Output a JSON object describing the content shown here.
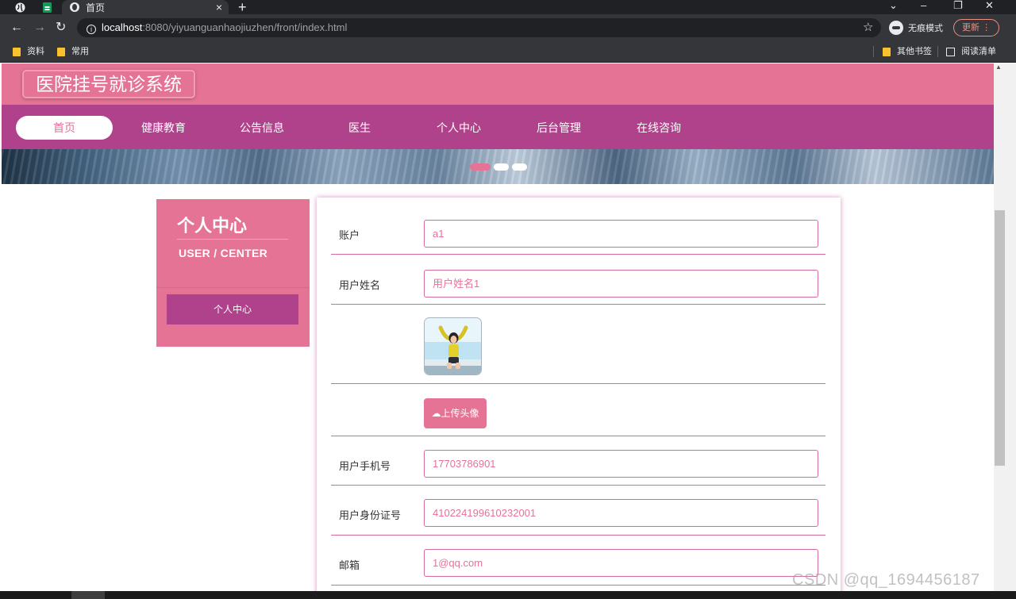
{
  "browser": {
    "tab_title": "首页",
    "address_host": "localhost",
    "address_path": ":8080/yiyuanguanhaojiuzhen/front/index.html",
    "incognito_label": "无痕模式",
    "update_label": "更新",
    "bookmarks": [
      "资料",
      "常用"
    ],
    "other_bookmarks": "其他书签",
    "reading_list": "阅读清单"
  },
  "site": {
    "title": "医院挂号就诊系统",
    "nav": [
      "首页",
      "健康教育",
      "公告信息",
      "医生",
      "个人中心",
      "后台管理",
      "在线咨询"
    ],
    "active_nav": "首页"
  },
  "sidebar": {
    "title": "个人中心",
    "subtitle": "USER / CENTER",
    "menu_item": "个人中心"
  },
  "form": {
    "account_label": "账户",
    "account_value": "a1",
    "name_label": "用户姓名",
    "name_value": "用户姓名1",
    "upload_label": "上传头像",
    "phone_label": "用户手机号",
    "phone_value": "17703786901",
    "idcard_label": "用户身份证号",
    "idcard_value": "410224199610232001",
    "email_label": "邮箱",
    "email_value": "1@qq.com"
  },
  "watermark": "CSDN @qq_1694456187",
  "colors": {
    "header": "#e57396",
    "nav": "#b0428b",
    "accent": "#e57396"
  }
}
